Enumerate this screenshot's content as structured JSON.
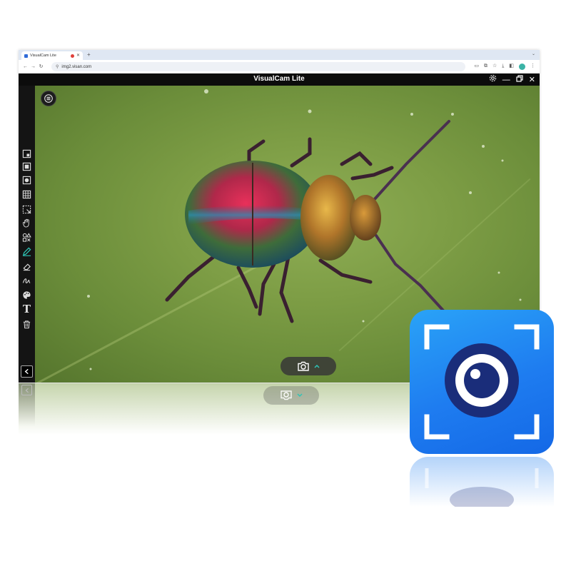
{
  "browser": {
    "tab_title": "VisualCam Lite",
    "new_tab_label": "+",
    "url": "img2.visan.com"
  },
  "app": {
    "title": "VisualCam Lite"
  },
  "sidebar": {
    "tools": [
      {
        "name": "window-capture-icon"
      },
      {
        "name": "fullscreen-capture-icon"
      },
      {
        "name": "circle-capture-icon"
      },
      {
        "name": "grid-icon"
      },
      {
        "name": "region-select-icon"
      },
      {
        "name": "hand-pan-icon"
      },
      {
        "name": "shapes-icon"
      },
      {
        "name": "pen-icon",
        "active": true
      },
      {
        "name": "eraser-icon"
      },
      {
        "name": "freehand-icon"
      },
      {
        "name": "palette-icon"
      },
      {
        "name": "text-tool-icon",
        "label": "T"
      },
      {
        "name": "trash-icon"
      }
    ]
  },
  "colors": {
    "accent": "#2ec4b6",
    "app_icon_blue": "#1e7cf0",
    "app_icon_eye": "#1a2d7a"
  }
}
